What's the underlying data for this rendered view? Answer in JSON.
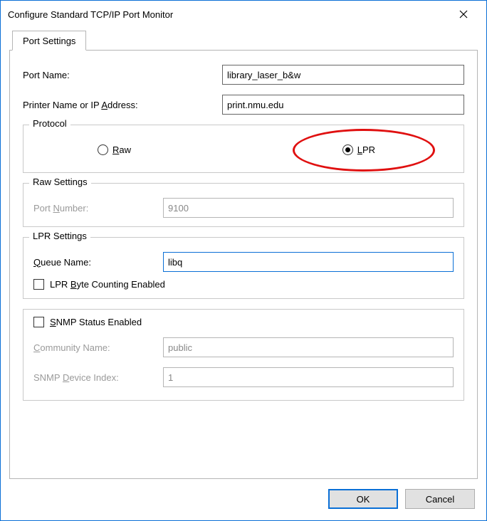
{
  "window": {
    "title": "Configure Standard TCP/IP Port Monitor"
  },
  "tab": {
    "label": "Port Settings"
  },
  "fields": {
    "port_name_label": "Port Name:",
    "port_name_value": "library_laser_b&w",
    "printer_label_prefix": "Printer Name or IP ",
    "printer_label_ul": "A",
    "printer_label_suffix": "ddress:",
    "printer_value": "print.nmu.edu"
  },
  "protocol": {
    "legend": "Protocol",
    "raw_ul": "R",
    "raw_suffix": "aw",
    "lpr_ul": "L",
    "lpr_suffix": "PR",
    "selected": "lpr"
  },
  "raw_settings": {
    "legend": "Raw Settings",
    "port_number_prefix": "Port ",
    "port_number_ul": "N",
    "port_number_suffix": "umber:",
    "port_number_value": "9100"
  },
  "lpr_settings": {
    "legend": "LPR Settings",
    "queue_prefix": "",
    "queue_ul": "Q",
    "queue_suffix": "ueue Name:",
    "queue_value": "libq",
    "byte_prefix": "LPR ",
    "byte_ul": "B",
    "byte_suffix": "yte Counting Enabled"
  },
  "snmp": {
    "enable_ul": "S",
    "enable_suffix": "NMP Status Enabled",
    "community_ul": "C",
    "community_suffix": "ommunity Name:",
    "community_value": "public",
    "index_prefix": "SNMP ",
    "index_ul": "D",
    "index_suffix": "evice Index:",
    "index_value": "1"
  },
  "buttons": {
    "ok": "OK",
    "cancel": "Cancel"
  }
}
